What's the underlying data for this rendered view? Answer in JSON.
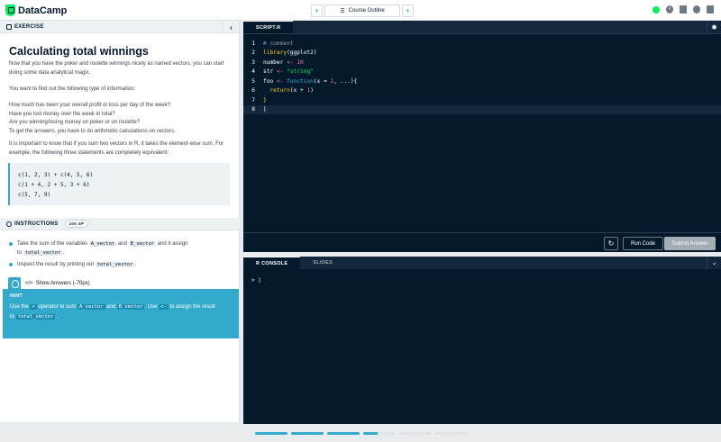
{
  "app": {
    "name": "DataCamp"
  },
  "topnav": {
    "prev_label": "+",
    "course_outline": "Course Outline",
    "next_label": "+"
  },
  "exercise": {
    "header": "EXERCISE",
    "title": "Calculating total winnings",
    "paragraphs": [
      "Now that you have the poker and roulette winnings nicely as named vectors, you can start doing some data analytical magic.",
      "You want to find out the following type of information:",
      "How much has been your overall profit or loss per day of the week?",
      "Have you lost money over the week in total?",
      "Are you winning/losing money on poker or on roulette?",
      "To get the answers, you have to do arithmetic calculations on vectors.",
      "It is important to know that if you sum two vectors in R, it takes the element-wise sum. For example, the following three statements are completely equivalent:"
    ],
    "code_lines": [
      "c(1, 2, 3) + c(4, 5, 6)",
      "c(1 + 4, 2 + 5, 3 + 6)",
      "c(5, 7, 9)"
    ]
  },
  "instructions": {
    "header": "INSTRUCTIONS",
    "xp": "100 XP",
    "items": [
      {
        "pre": "Take the sum of the variables",
        "c1": "A_vector",
        "mid": "and",
        "c2": "B_vector",
        "post": "and it assign",
        "to": "to",
        "c3": "total_vector",
        "end": "."
      },
      {
        "pre": "Inspect the result by printing out",
        "c1": "total_vector",
        "end": "."
      }
    ]
  },
  "hint": {
    "show_answers": "Show Answers (-70px)",
    "title": "HINT",
    "t1": "Use the",
    "c1": "+",
    "t2": "operator to sum",
    "c2": "A_vector",
    "t3": "and",
    "c3": "B_vector",
    "t4": ". Use",
    "c4": "<-",
    "t5": "to assign the result",
    "t6": "to",
    "c5": "total_vector",
    "t7": "."
  },
  "editor": {
    "tab": "SCRIPT.R",
    "line_numbers": [
      "1",
      "2",
      "3",
      "4",
      "5",
      "6",
      "7",
      "8"
    ],
    "reset_icon": "reset-icon",
    "run_label": "Run Code",
    "submit_label": "Submit Answer"
  },
  "console": {
    "tabs": [
      "R CONSOLE",
      "SLIDES"
    ],
    "prompt": ">"
  },
  "progress": {
    "segments": [
      1,
      1,
      1,
      0.45,
      0,
      0
    ]
  },
  "colors": {
    "accent": "#33aacc",
    "editor_bg": "#05192d",
    "brand_green": "#03ef62"
  }
}
